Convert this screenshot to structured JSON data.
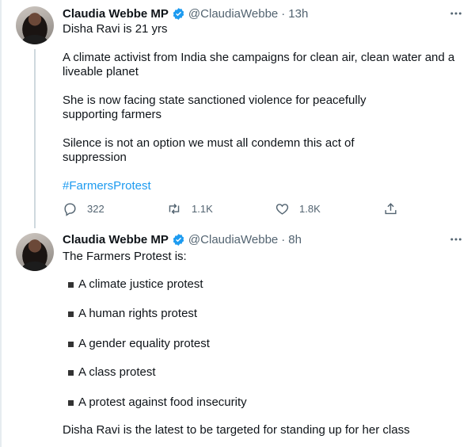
{
  "tweets": [
    {
      "author": {
        "name": "Claudia Webbe MP",
        "handle": "@ClaudiaWebbe"
      },
      "time": "13h",
      "paragraphs": [
        "Disha Ravi is 21 yrs",
        "A climate activist from India she campaigns for clean air, clean water and a liveable planet",
        "She is now facing state sanctioned violence for peacefully supporting farmers",
        "Silence is not an option we must all condemn this act of suppression"
      ],
      "hashtag": "#FarmersProtest",
      "actions": {
        "replies": "322",
        "retweets": "1.1K",
        "likes": "1.8K"
      }
    },
    {
      "author": {
        "name": "Claudia Webbe MP",
        "handle": "@ClaudiaWebbe"
      },
      "time": "8h",
      "intro": "The Farmers Protest is:",
      "bullets": [
        "A climate justice protest",
        "A human rights protest",
        "A gender equality protest",
        "A class protest",
        "A protest against food insecurity"
      ],
      "closing": "Disha Ravi is the latest to be targeted for standing up for her class"
    }
  ],
  "separator": "·",
  "colors": {
    "verified": "#1d9bf0",
    "hashtag": "#1d9bf0",
    "secondary_text": "#536471",
    "thread_line": "#cfd9de"
  },
  "icons": [
    "verified-badge-icon",
    "more-icon",
    "reply-icon",
    "retweet-icon",
    "like-icon",
    "share-icon"
  ]
}
